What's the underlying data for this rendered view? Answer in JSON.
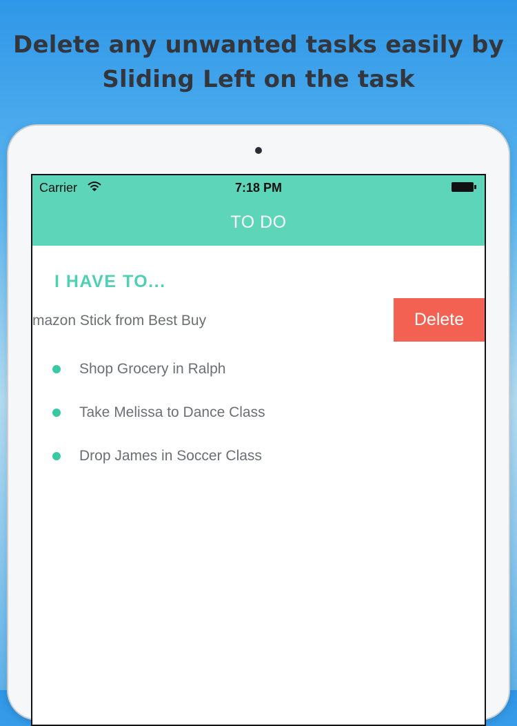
{
  "headline": {
    "line1": "Delete any unwanted tasks easily by",
    "line2": "Sliding Left on the task"
  },
  "statusbar": {
    "carrier": "Carrier",
    "time": "7:18 PM",
    "wifi_icon": "wifi-icon",
    "battery_icon": "battery-icon"
  },
  "navbar": {
    "title": "TO DO"
  },
  "list": {
    "section_title": "I HAVE TO...",
    "swiped_task": "mazon Stick from Best Buy",
    "delete_label": "Delete",
    "tasks": [
      {
        "label": "Shop Grocery in Ralph"
      },
      {
        "label": "Take Melissa to Dance Class"
      },
      {
        "label": "Drop James in Soccer Class"
      }
    ]
  },
  "colors": {
    "accent": "#5dd5b8",
    "delete": "#f26151",
    "bullet": "#39c9a2"
  }
}
